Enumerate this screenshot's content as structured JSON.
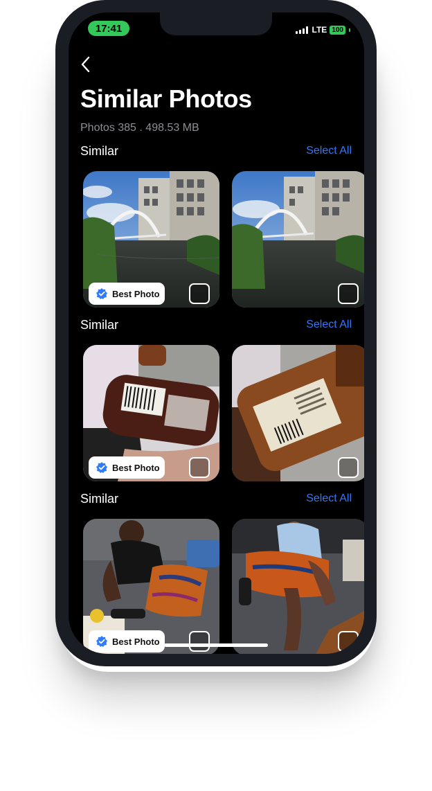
{
  "status": {
    "time": "17:41",
    "network": "LTE",
    "battery": "100"
  },
  "header": {
    "title": "Similar Photos",
    "subtitle": "Photos 385 . 498.53 MB"
  },
  "groups": [
    {
      "title": "Similar",
      "select_all": "Select All",
      "badge": "Best Photo"
    },
    {
      "title": "Similar",
      "select_all": "Select All",
      "badge": "Best Photo"
    },
    {
      "title": "Similar",
      "select_all": "Select All",
      "badge": "Best Photo"
    }
  ],
  "colors": {
    "accent": "#3478f6",
    "status_green": "#34c759",
    "background": "#000000"
  },
  "icons": {
    "back": "chevron-left-icon",
    "verified": "verified-check-icon",
    "checkbox": "checkbox-icon"
  }
}
